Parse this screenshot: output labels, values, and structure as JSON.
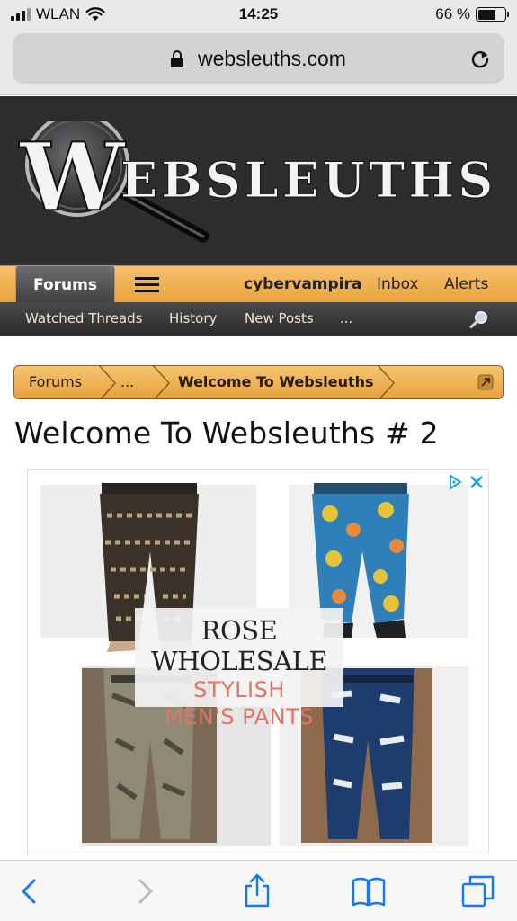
{
  "status_bar": {
    "carrier": "WLAN",
    "time": "14:25",
    "battery": "66 %",
    "battery_level": 0.66
  },
  "browser": {
    "url": "websleuths.com"
  },
  "site": {
    "logo_text": "WEBSLEUTHS"
  },
  "nav": {
    "forums_tab": "Forums",
    "username": "cybervampira",
    "inbox": "Inbox",
    "alerts": "Alerts"
  },
  "subnav": {
    "watched_threads": "Watched Threads",
    "history": "History",
    "new_posts": "New Posts",
    "more": "..."
  },
  "breadcrumb": {
    "items": [
      "Forums",
      "...",
      "Welcome To Websleuths"
    ]
  },
  "page": {
    "title": "Welcome To Websleuths # 2"
  },
  "ad": {
    "brand": "ROSE WHOLESALE",
    "line1": "STYLISH",
    "line2": "MEN'S PANTS"
  },
  "colors": {
    "nav_orange": "#f0b455",
    "header_dark": "#2d2d2f",
    "ad_accent": "#e07566"
  }
}
